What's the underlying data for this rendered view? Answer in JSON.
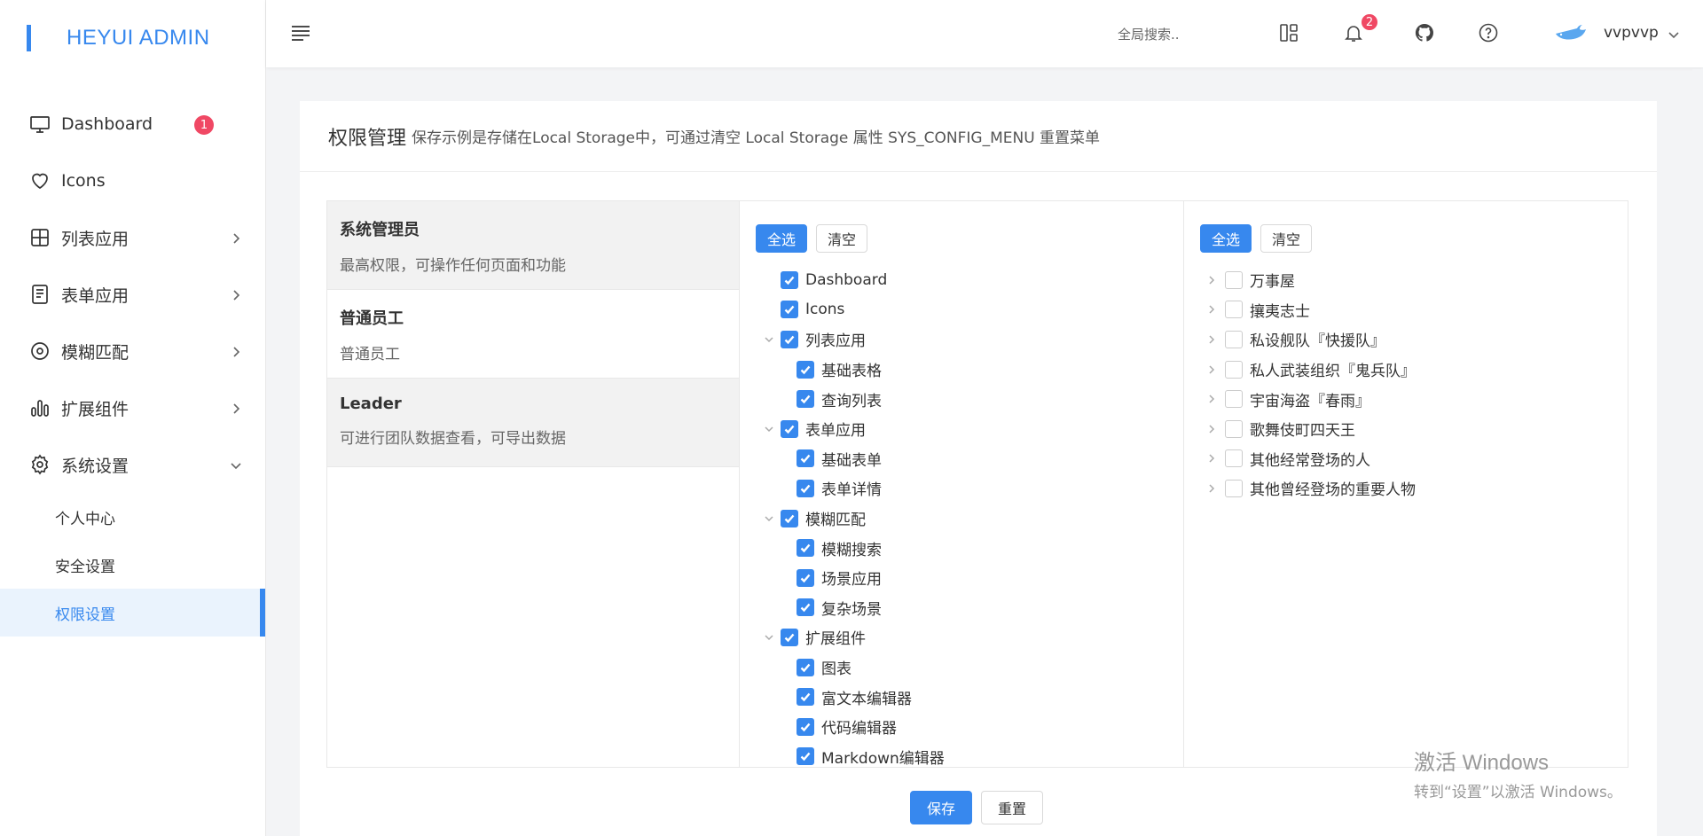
{
  "app": {
    "logo": "HEYUI ADMIN"
  },
  "sidebar": {
    "items": [
      {
        "label": "Dashboard",
        "icon": "monitor-icon",
        "badge": "1"
      },
      {
        "label": "Icons",
        "icon": "heart-icon"
      },
      {
        "label": "列表应用",
        "icon": "grid-icon"
      },
      {
        "label": "表单应用",
        "icon": "document-icon"
      },
      {
        "label": "模糊匹配",
        "icon": "target-icon"
      },
      {
        "label": "扩展组件",
        "icon": "bar-chart-icon"
      },
      {
        "label": "系统设置",
        "icon": "gear-icon"
      }
    ],
    "subitems": [
      {
        "label": "个人中心"
      },
      {
        "label": "安全设置"
      },
      {
        "label": "权限设置",
        "active": true
      }
    ]
  },
  "header": {
    "search_placeholder": "全局搜索..",
    "notification_count": "2",
    "username": "vvpvvp"
  },
  "card": {
    "title": "权限管理",
    "desc": "保存示例是存储在Local Storage中，可通过清空 Local Storage 属性 SYS_CONFIG_MENU 重置菜单"
  },
  "roles": [
    {
      "name": "系统管理员",
      "desc": "最高权限，可操作任何页面和功能",
      "selected": true
    },
    {
      "name": "普通员工",
      "desc": "普通员工",
      "selected": false
    },
    {
      "name": "Leader",
      "desc": "可进行团队数据查看，可导出数据",
      "selected": false
    }
  ],
  "buttons": {
    "select_all": "全选",
    "clear": "清空",
    "save": "保存",
    "reset": "重置"
  },
  "menu_tree": [
    {
      "label": "Dashboard",
      "level": 0,
      "checked": true,
      "expandable": false
    },
    {
      "label": "Icons",
      "level": 0,
      "checked": true,
      "expandable": false
    },
    {
      "label": "列表应用",
      "level": 0,
      "checked": true,
      "expandable": true
    },
    {
      "label": "基础表格",
      "level": 1,
      "checked": true
    },
    {
      "label": "查询列表",
      "level": 1,
      "checked": true
    },
    {
      "label": "表单应用",
      "level": 0,
      "checked": true,
      "expandable": true
    },
    {
      "label": "基础表单",
      "level": 1,
      "checked": true
    },
    {
      "label": "表单详情",
      "level": 1,
      "checked": true
    },
    {
      "label": "模糊匹配",
      "level": 0,
      "checked": true,
      "expandable": true
    },
    {
      "label": "模糊搜索",
      "level": 1,
      "checked": true
    },
    {
      "label": "场景应用",
      "level": 1,
      "checked": true
    },
    {
      "label": "复杂场景",
      "level": 1,
      "checked": true
    },
    {
      "label": "扩展组件",
      "level": 0,
      "checked": true,
      "expandable": true
    },
    {
      "label": "图表",
      "level": 1,
      "checked": true
    },
    {
      "label": "富文本编辑器",
      "level": 1,
      "checked": true
    },
    {
      "label": "代码编辑器",
      "level": 1,
      "checked": true
    },
    {
      "label": "Markdown编辑器",
      "level": 1,
      "checked": true
    }
  ],
  "org_tree": [
    {
      "label": "万事屋",
      "checked": false
    },
    {
      "label": "攘夷志士",
      "checked": false
    },
    {
      "label": "私设舰队『快援队』",
      "checked": false
    },
    {
      "label": "私人武装组织『鬼兵队』",
      "checked": false
    },
    {
      "label": "宇宙海盗『春雨』",
      "checked": false
    },
    {
      "label": "歌舞伎町四天王",
      "checked": false
    },
    {
      "label": "其他经常登场的人",
      "checked": false
    },
    {
      "label": "其他曾经登场的重要人物",
      "checked": false
    }
  ],
  "watermark": {
    "line1": "激活 Windows",
    "line2": "转到“设置”以激活 Windows。"
  },
  "colors": {
    "primary": "#3788ee",
    "badge": "#f04864"
  }
}
